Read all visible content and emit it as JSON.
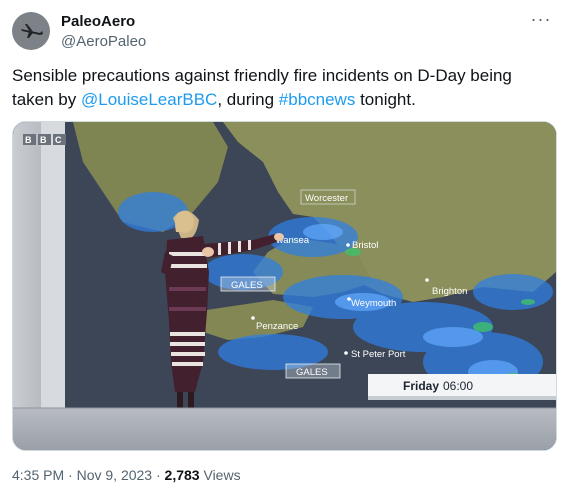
{
  "author": {
    "name": "PaleoAero",
    "handle": "@AeroPaleo",
    "avatar_icon": "airplane-silhouette-icon",
    "more_icon": "more-options-icon"
  },
  "tweet": {
    "text_part1": "Sensible precautions against friendly fire incidents on D-Day being taken by ",
    "mention": "@LouiseLearBBC",
    "text_part2": ", during ",
    "hashtag": "#bbcnews",
    "text_part3": " tonight."
  },
  "media": {
    "broadcaster_logo": "BBC",
    "place_labels": [
      "Worcester",
      "Swansea",
      "Bristol",
      "Brighton",
      "Weymouth",
      "Penzance",
      "St Peter Port"
    ],
    "wind_labels": [
      "GALES",
      "GALES"
    ],
    "time_label_day": "Friday",
    "time_label_time": "06:00"
  },
  "footer": {
    "time": "4:35 PM",
    "separator": "·",
    "date": "Nov 9, 2023",
    "views_count": "2,783",
    "views_label": "Views"
  },
  "colors": {
    "link": "#1d9bf0",
    "secondary_text": "#536471",
    "land": "#8a8f5a",
    "sea": "#3a4454",
    "rain": "#2e7de0"
  }
}
